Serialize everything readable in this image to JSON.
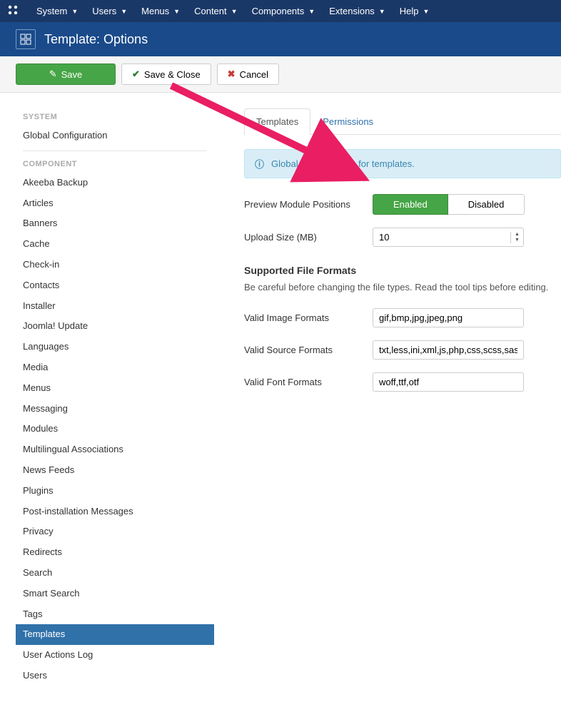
{
  "topnav": {
    "items": [
      "System",
      "Users",
      "Menus",
      "Content",
      "Components",
      "Extensions",
      "Help"
    ]
  },
  "titlebar": {
    "title": "Template: Options"
  },
  "toolbar": {
    "save": "Save",
    "save_close": "Save & Close",
    "cancel": "Cancel"
  },
  "sidebar": {
    "system_heading": "SYSTEM",
    "global_config": "Global Configuration",
    "component_heading": "COMPONENT",
    "components": [
      "Akeeba Backup",
      "Articles",
      "Banners",
      "Cache",
      "Check-in",
      "Contacts",
      "Installer",
      "Joomla! Update",
      "Languages",
      "Media",
      "Menus",
      "Messaging",
      "Modules",
      "Multilingual Associations",
      "News Feeds",
      "Plugins",
      "Post-installation Messages",
      "Privacy",
      "Redirects",
      "Search",
      "Smart Search",
      "Tags",
      "Templates",
      "User Actions Log",
      "Users"
    ],
    "active_index": 22
  },
  "tabs": {
    "templates": "Templates",
    "permissions": "Permissions"
  },
  "info": {
    "text": "Global Configuration for templates."
  },
  "form": {
    "preview_label": "Preview Module Positions",
    "enabled": "Enabled",
    "disabled": "Disabled",
    "upload_label": "Upload Size (MB)",
    "upload_value": "10",
    "section_heading": "Supported File Formats",
    "section_sub": "Be careful before changing the file types. Read the tool tips before editing.",
    "valid_image_label": "Valid Image Formats",
    "valid_image_value": "gif,bmp,jpg,jpeg,png",
    "valid_source_label": "Valid Source Formats",
    "valid_source_value": "txt,less,ini,xml,js,php,css,scss,sass",
    "valid_font_label": "Valid Font Formats",
    "valid_font_value": "woff,ttf,otf"
  }
}
